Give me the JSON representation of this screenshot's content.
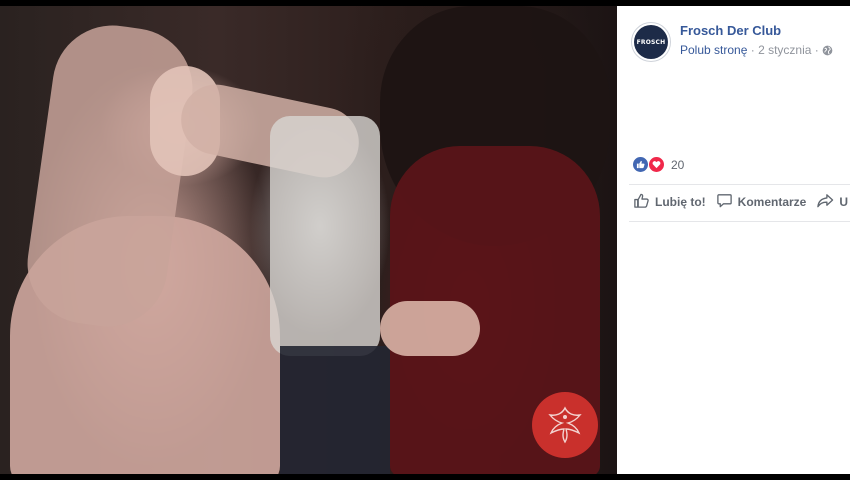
{
  "post": {
    "page_name": "Frosch Der Club",
    "follow_link": "Polub stronę",
    "separator": "·",
    "date": "2 stycznia",
    "privacy_icon": "globe-icon",
    "avatar_text": "FROSCH"
  },
  "reactions": {
    "icons": [
      "like-reaction-icon",
      "love-reaction-icon"
    ],
    "count": "20"
  },
  "actions": {
    "like_label": "Lubię to!",
    "comment_label": "Komentarze",
    "share_label": "U"
  },
  "colors": {
    "link": "#365899",
    "muted": "#90949c",
    "like_blue": "#4267b2",
    "love_red": "#f0284a",
    "logo_red": "#c9302c"
  }
}
